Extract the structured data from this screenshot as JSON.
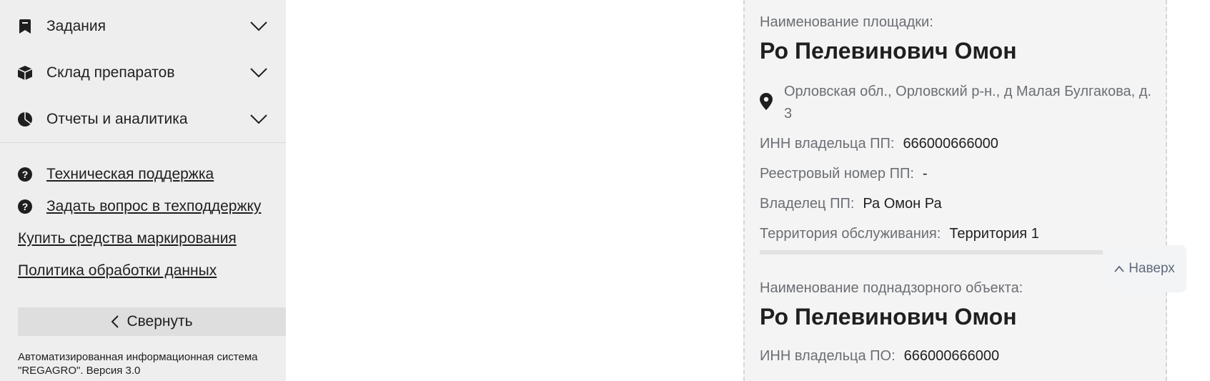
{
  "sidebar": {
    "nav": [
      {
        "label": "Задания",
        "icon": "bookmark-icon"
      },
      {
        "label": "Склад препаратов",
        "icon": "box-icon"
      },
      {
        "label": "Отчеты и аналитика",
        "icon": "pie-chart-icon"
      }
    ],
    "help": [
      {
        "label": "Техническая поддержка",
        "icon": "question-circle-icon"
      },
      {
        "label": "Задать вопрос в техподдержку",
        "icon": "question-circle-icon"
      }
    ],
    "links": [
      {
        "label": "Купить средства маркирования"
      },
      {
        "label": "Политика обработки данных"
      }
    ],
    "collapse_label": "Свернуть",
    "footer": "Автоматизированная информационная система \"REGAGRO\". Версия 3.0"
  },
  "card": {
    "site_label": "Наименование площадки:",
    "site_name": "Ро Пелевинович Омон",
    "address": "Орловская обл., Орловский р-н., д Малая Булгакова, д. 3",
    "fields": [
      {
        "key": "ИНН владельца ПП:",
        "value": "666000666000"
      },
      {
        "key": "Реестровый номер ПП:",
        "value": "-"
      },
      {
        "key": "Владелец ПП:",
        "value": "Ра Омон Ра"
      },
      {
        "key": "Территория обслуживания:",
        "value": "Территория 1"
      }
    ],
    "object_label": "Наименование поднадзорного объекта:",
    "object_name": "Ро Пелевинович Омон",
    "object_fields": [
      {
        "key": "ИНН владельца ПО:",
        "value": "666000666000"
      }
    ]
  },
  "scroll_top_label": "Наверх"
}
